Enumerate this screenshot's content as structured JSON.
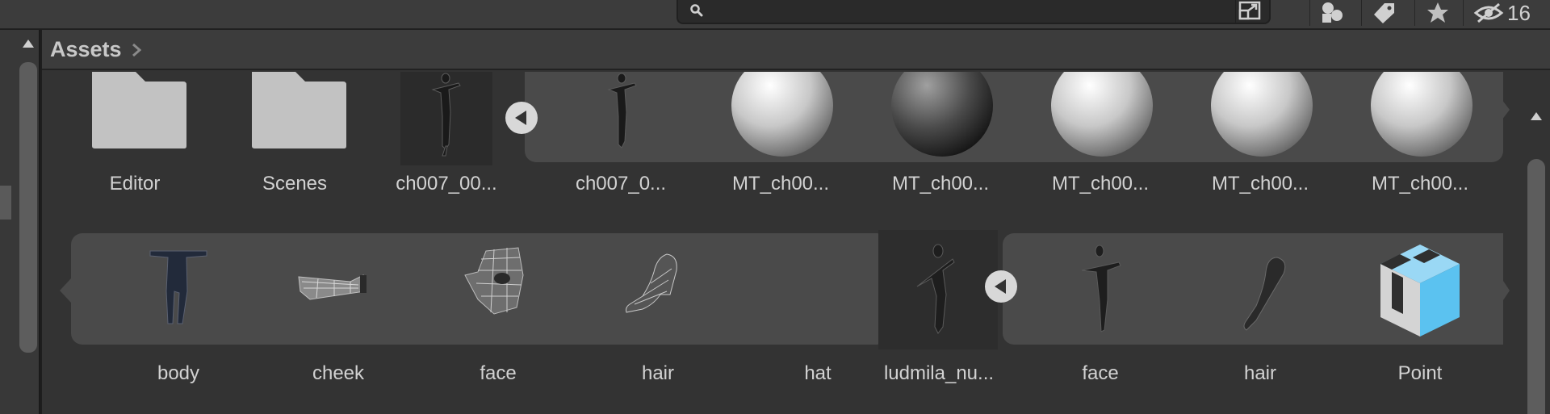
{
  "toolbar": {
    "search_value": "",
    "hidden_count": "16"
  },
  "breadcrumb": {
    "root": "Assets"
  },
  "row1": {
    "folders": [
      {
        "label": "Editor",
        "icon": "folder-icon"
      },
      {
        "label": "Scenes",
        "icon": "folder-icon"
      }
    ],
    "model": {
      "label": "ch007_00..."
    },
    "children": [
      {
        "label": "ch007_0...",
        "icon": "mesh-figure-icon"
      },
      {
        "label": "MT_ch00...",
        "icon": "material-sphere-icon"
      },
      {
        "label": "MT_ch00...",
        "icon": "material-sphere-dark-icon"
      },
      {
        "label": "MT_ch00...",
        "icon": "material-sphere-icon"
      },
      {
        "label": "MT_ch00...",
        "icon": "material-sphere-icon"
      },
      {
        "label": "MT_ch00...",
        "icon": "material-sphere-icon"
      }
    ]
  },
  "row2": {
    "group_children": [
      {
        "label": "body",
        "icon": "body-mesh-icon"
      },
      {
        "label": "cheek",
        "icon": "cheek-mesh-icon"
      },
      {
        "label": "face",
        "icon": "face-mesh-icon"
      },
      {
        "label": "hair",
        "icon": "hair-mesh-icon"
      },
      {
        "label": "hat",
        "icon": "empty-mesh-icon"
      }
    ],
    "model": {
      "label": "ludmila_nu..."
    },
    "children": [
      {
        "label": "face",
        "icon": "mesh-figure-icon"
      },
      {
        "label": "hair",
        "icon": "hair-mesh-icon"
      },
      {
        "label": "Point",
        "icon": "prefab-cube-icon"
      }
    ]
  },
  "colors": {
    "background": "#333333",
    "strip": "#4a4a4a",
    "prefab_blue": "#5bc2f0"
  }
}
